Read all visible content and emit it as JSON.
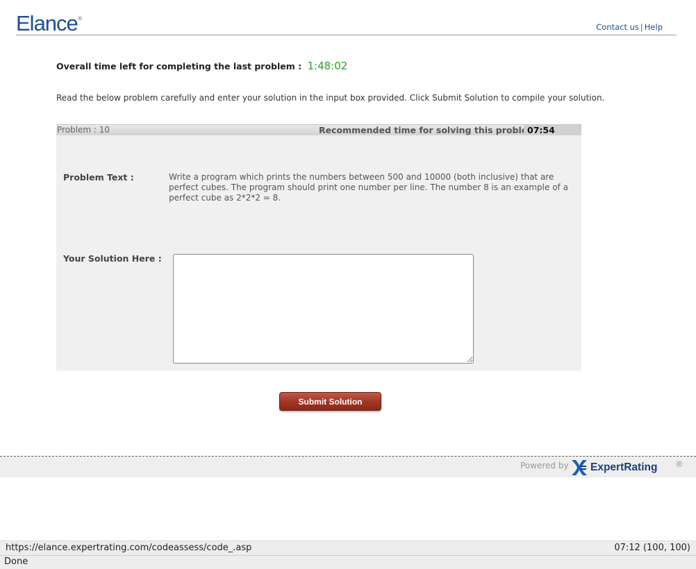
{
  "header": {
    "logo_text": "Elance",
    "logo_mark": "®",
    "contact_label": "Contact us",
    "separator": "|",
    "help_label": "Help"
  },
  "timer": {
    "label": "Overall time left for completing the last problem :",
    "value": "1:48:02"
  },
  "instructions": "Read the below problem carefully and enter your solution in the input box provided. Click Submit Solution to compile your solution.",
  "problem": {
    "number_label": "Problem : 10",
    "recommended_label": "Recommended time for solving this problem :",
    "recommended_time": "07:54",
    "text_label": "Problem Text :",
    "text": "Write a program which prints the numbers between 500 and 10000 (both inclusive) that are perfect cubes. The program should print one number per line. The number 8 is an example of a perfect cube as 2*2*2 = 8.",
    "solution_label": "Your Solution Here :",
    "solution_value": ""
  },
  "submit_label": "Submit Solution",
  "footer": {
    "powered_by": "Powered by",
    "brand": "ExpertRating",
    "registered": "®"
  },
  "statusbar": {
    "url": "https://elance.expertrating.com/codeassess/code_.asp",
    "right": "07:12  (100, 100)",
    "status": "Done"
  },
  "colors": {
    "brand_blue": "#1d4f91",
    "timer_green": "#2a9d2a",
    "button_red": "#a33625"
  }
}
